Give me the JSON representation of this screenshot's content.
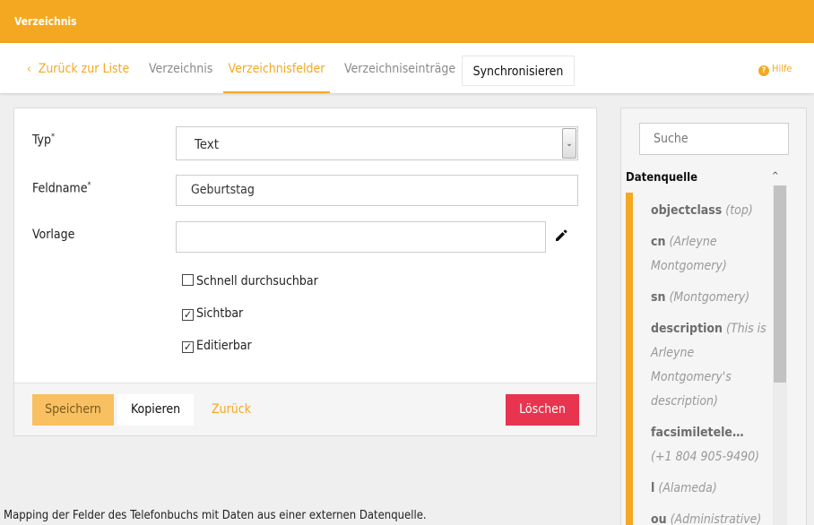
{
  "topbar": {
    "title": "Verzeichnis"
  },
  "nav": {
    "back_label": "Zurück zur Liste",
    "tabs": [
      "Verzeichnis",
      "Verzeichnisfelder",
      "Verzeichniseinträge"
    ],
    "sync_label": "Synchronisieren",
    "help_label": "Hilfe"
  },
  "form": {
    "type_label": "Typ",
    "type_value": "Text",
    "fieldname_label": "Feldname",
    "fieldname_value": "Geburtstag",
    "template_label": "Vorlage",
    "template_value": "",
    "checkboxes": [
      {
        "label": "Schnell durchsuchbar",
        "checked": false
      },
      {
        "label": "Sichtbar",
        "checked": true
      },
      {
        "label": "Editierbar",
        "checked": true
      }
    ]
  },
  "buttons": {
    "save": "Speichern",
    "copy": "Kopieren",
    "back": "Zurück",
    "delete": "Löschen"
  },
  "footnote": "Mapping der Felder des Telefonbuchs mit Daten aus einer externen Datenquelle.",
  "sidebar": {
    "search_placeholder": "Suche",
    "title": "Datenquelle",
    "items": [
      {
        "name": "objectclass",
        "value": "(top)"
      },
      {
        "name": "cn",
        "value": "(Arleyne Montgomery)"
      },
      {
        "name": "sn",
        "value": "(Montgomery)"
      },
      {
        "name": "description",
        "value": "(This is Arleyne Montgomery's description)"
      },
      {
        "name": "facsimiletelepho...",
        "value": "(+1 804 905-9490)"
      },
      {
        "name": "l",
        "value": "(Alameda)"
      },
      {
        "name": "ou",
        "value": "(Administrative)"
      }
    ]
  },
  "colors": {
    "accent": "#f4a821",
    "danger": "#e8344e",
    "save_bg": "#f8c060"
  }
}
